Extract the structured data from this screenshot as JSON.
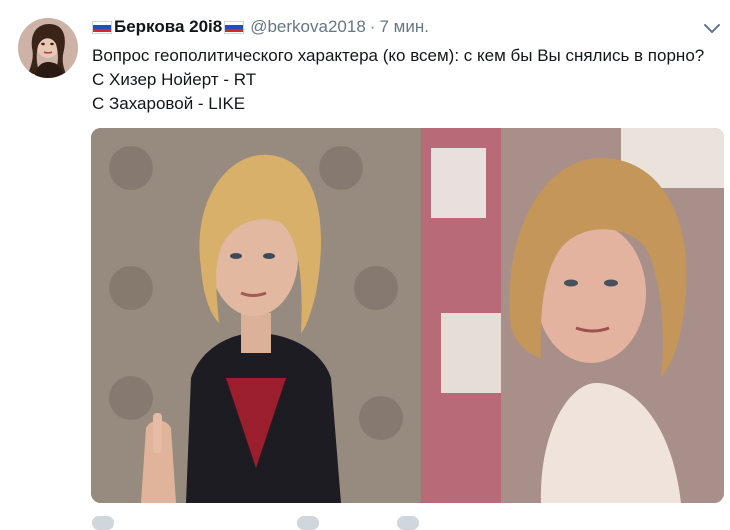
{
  "tweet": {
    "author_name": "Беркова 20i8",
    "handle": "@berkova2018",
    "separator": "·",
    "time": "7 мин.",
    "lines": [
      "Вопрос геополитического характера (ко всем): с кем бы Вы снялись в порно?",
      "С Хизер Нойерт - RT",
      "С Захаровой - LIKE"
    ]
  },
  "icons": {
    "flag": "russian-flag-icon",
    "menu": "chevron-down-icon"
  },
  "colors": {
    "secondary_text": "#657786",
    "flag_white": "#ffffff",
    "flag_blue": "#1f4fbf",
    "flag_red": "#d52b1e"
  }
}
